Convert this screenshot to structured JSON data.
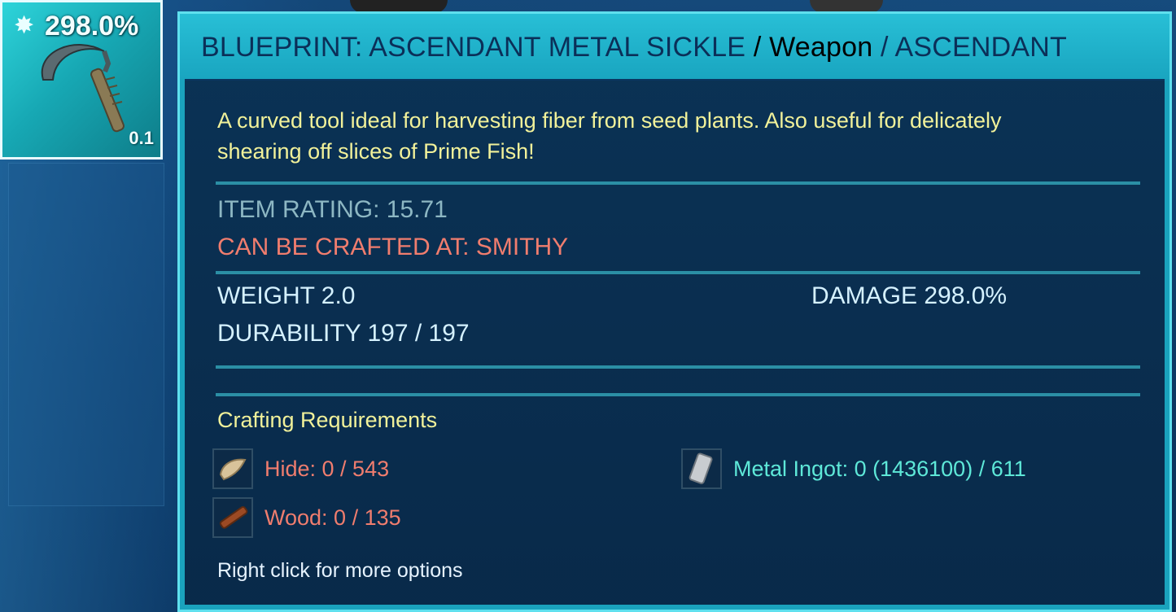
{
  "item_slot": {
    "quality_percent": "298.0%",
    "weight": "0.1"
  },
  "tooltip": {
    "title_name": "BLUEPRINT: ASCENDANT METAL SICKLE",
    "title_sep1": "/",
    "title_type": "Weapon",
    "title_sep2": "/",
    "title_quality": "ASCENDANT",
    "description": "A curved tool ideal for harvesting fiber from seed plants. Also useful for delicately shearing off slices of Prime Fish!",
    "item_rating": "ITEM RATING: 15.71",
    "crafted_at": "CAN BE CRAFTED AT: SMITHY",
    "weight": "WEIGHT 2.0",
    "durability": "DURABILITY 197 / 197",
    "damage": "DAMAGE 298.0%",
    "crafting_requirements_title": "Crafting Requirements",
    "requirements": [
      {
        "text": "Hide: 0 / 543",
        "color": "#f07d6e",
        "icon": "hide-icon"
      },
      {
        "text": "Wood: 0 / 135",
        "color": "#f07d6e",
        "icon": "wood-icon"
      },
      {
        "text": "Metal Ingot: 0 (1436100) / 611",
        "color": "#5ee8d8",
        "icon": "metal-ingot-icon"
      }
    ],
    "hint": "Right click for more options"
  },
  "colors": {
    "title_bar": "#1aa2bd",
    "description": "#f1f19a",
    "missing_resource": "#f07d6e",
    "available_resource": "#5ee8d8"
  }
}
